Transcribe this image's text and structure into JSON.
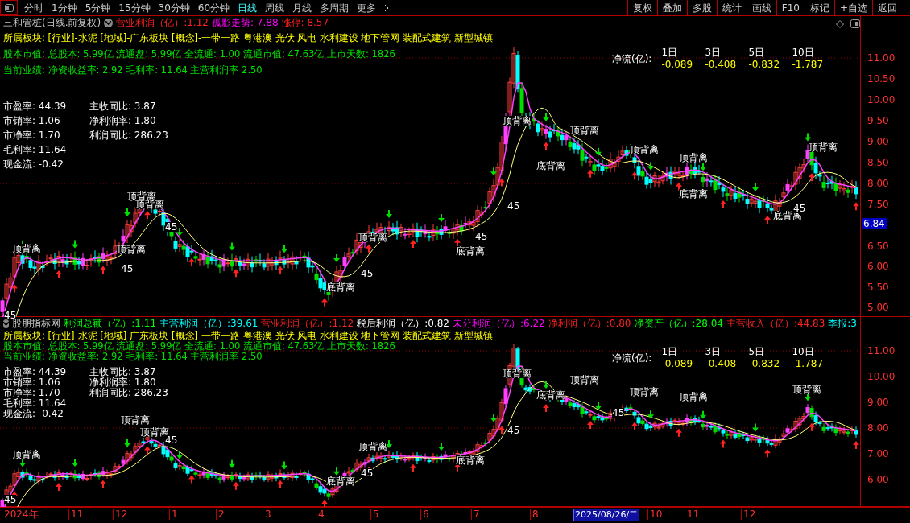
{
  "toolbar": {
    "periods": [
      {
        "label": "分时",
        "selected": false
      },
      {
        "label": "1分钟",
        "selected": false
      },
      {
        "label": "5分钟",
        "selected": false
      },
      {
        "label": "15分钟",
        "selected": false
      },
      {
        "label": "30分钟",
        "selected": false
      },
      {
        "label": "60分钟",
        "selected": false
      },
      {
        "label": "日线",
        "selected": true
      },
      {
        "label": "周线",
        "selected": false
      },
      {
        "label": "月线",
        "selected": false
      },
      {
        "label": "多周期",
        "selected": false
      },
      {
        "label": "更多",
        "selected": false
      }
    ],
    "buttons": [
      "复权",
      "叠加",
      "多股",
      "统计",
      "画线",
      "F10",
      "标记",
      "+自选",
      "返回"
    ]
  },
  "upper_pane": {
    "title": "三和管桩(日线.前复权)",
    "indicators": [
      {
        "label": "营业利润（亿）",
        "value": ":1.12",
        "color": "#ff2020"
      },
      {
        "label": "孤影走势",
        "value": ": 7.88",
        "color": "#ff00ff"
      },
      {
        "label": "涨停",
        "value": ": 8.57",
        "color": "#ff2020"
      }
    ],
    "sectors": "所属板块: [行业]-水泥 [地域]-广东板块 [概念]-一带一路 粤港澳 光伏 风电 水利建设 地下管网 装配式建筑 新型城镇",
    "market_cap": "股本市值: 总股本: 5.99亿 流通盘: 5.99亿 全流通: 1.00 流通市值: 47.63亿 上市天数: 1826",
    "performance": "当前业绩: 净资收益率: 2.92 毛利率: 11.64 主营利润率 2.50",
    "ratios": [
      [
        "市盈率: 44.39",
        "市销率: 1.06",
        "市净率: 1.70",
        "毛利率: 11.64",
        "现金流: -0.42"
      ],
      [
        "主收同比: 3.87",
        "净利润率: 1.80",
        "利润同比: 286.23"
      ]
    ],
    "net_flow": {
      "label": "净流(亿):",
      "columns": [
        {
          "period": "1日",
          "value": "-0.089"
        },
        {
          "period": "3日",
          "value": "-0.408"
        },
        {
          "period": "5日",
          "value": "-0.832"
        },
        {
          "period": "10日",
          "value": "-1.787"
        }
      ]
    },
    "price_axis": [
      "11.00",
      "10.50",
      "10.00",
      "9.50",
      "9.00",
      "8.50",
      "8.00",
      "7.50",
      "6.50",
      "6.00",
      "5.50",
      "5.00"
    ],
    "current_price": "6.84",
    "chart_labels": [
      "顶背离",
      "顶背离",
      "顶背离",
      "顶背离",
      "顶背离",
      "顶背离",
      "顶背离",
      "顶背离",
      "顶背离",
      "顶背离",
      "底背离",
      "底背离",
      "底背离",
      "底背离",
      "底背离",
      "45",
      "45",
      "45",
      "45",
      "45",
      "45",
      "45"
    ]
  },
  "lower_pane": {
    "title": "股朋指标网",
    "indicators": [
      {
        "label": "利润总额（亿）",
        "value": ":1.11",
        "color": "#00ff00"
      },
      {
        "label": "主营利润（亿）",
        "value": ":39.61",
        "color": "#00ffff"
      },
      {
        "label": "营业利润（亿）",
        "value": ":1.12",
        "color": "#ff2020"
      },
      {
        "label": "税后利润（亿）",
        "value": ":0.82",
        "color": "#ffffff"
      },
      {
        "label": "未分利润（亿）",
        "value": ":6.22",
        "color": "#ff00ff"
      },
      {
        "label": "净利润（亿）",
        "value": ":0.80",
        "color": "#ff2020"
      },
      {
        "label": "净资产（亿）",
        "value": ":28.04",
        "color": "#00ff00"
      },
      {
        "label": "主营收入（亿）",
        "value": ":44.83",
        "color": "#ff2020"
      },
      {
        "label": "季报",
        "value": ":3",
        "color": "#00ffff"
      }
    ],
    "sectors": "所属板块: [行业]-水泥 [地域]-广东板块 [概念]-一带一路 粤港澳 光伏 风电 水利建设 地下管网 装配式建筑 新型城镇",
    "market_cap": "股本市值: 总股本: 5.99亿 流通盘: 5.99亿 全流通: 1.00 流通市值: 47.63亿 上市天数: 1826",
    "performance": "当前业绩: 净资收益率: 2.92 毛利率: 11.64 主营利润率 2.50",
    "ratios": [
      [
        "市盈率: 44.39",
        "市销率: 1.06",
        "市净率: 1.70",
        "毛利率: 11.64",
        "现金流: -0.42"
      ],
      [
        "主收同比: 3.87",
        "净利润率: 1.80",
        "利润同比: 286.23"
      ]
    ],
    "net_flow": {
      "label": "净流(亿):",
      "columns": [
        {
          "period": "1日",
          "value": "-0.089"
        },
        {
          "period": "3日",
          "value": "-0.408"
        },
        {
          "period": "5日",
          "value": "-0.832"
        },
        {
          "period": "10日",
          "value": "-1.787"
        }
      ]
    },
    "price_axis": [
      "11.00",
      "10.00",
      "9.00",
      "8.00",
      "7.00",
      "6.00"
    ],
    "chart_labels": [
      "顶背离",
      "顶背离",
      "顶背离",
      "顶背离",
      "顶背离",
      "顶背离",
      "顶背离",
      "顶背离",
      "顶背离",
      "底背离",
      "底背离",
      "底背离",
      "45",
      "45",
      "45",
      "45",
      "45"
    ]
  },
  "time_axis": [
    {
      "label": "2024年",
      "kind": "tick"
    },
    {
      "label": "11",
      "kind": "tick"
    },
    {
      "label": "12",
      "kind": "tick"
    },
    {
      "label": "1",
      "kind": "tick"
    },
    {
      "label": "2",
      "kind": "tick"
    },
    {
      "label": "3",
      "kind": "tick"
    },
    {
      "label": "4",
      "kind": "tick"
    },
    {
      "label": "5",
      "kind": "tick"
    },
    {
      "label": "6",
      "kind": "tick"
    },
    {
      "label": "7",
      "kind": "tick"
    },
    {
      "label": "8",
      "kind": "tick"
    },
    {
      "label": "2025/08/26/二",
      "kind": "cursor"
    },
    {
      "label": "10",
      "kind": "tick"
    },
    {
      "label": "11",
      "kind": "tick"
    },
    {
      "label": "12",
      "kind": "tick"
    }
  ]
}
